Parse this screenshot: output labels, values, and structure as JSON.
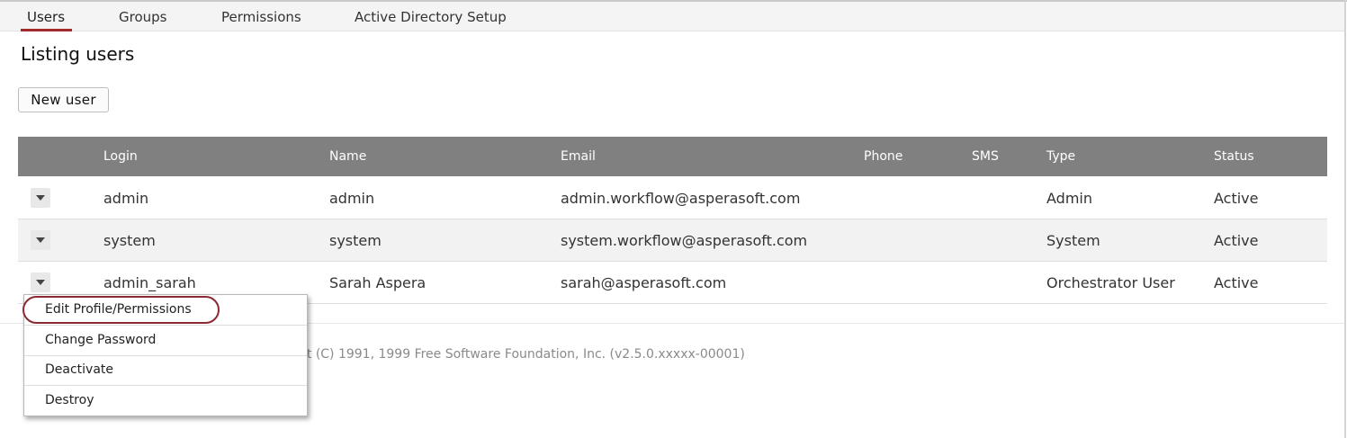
{
  "tabs": [
    {
      "label": "Users",
      "active": true
    },
    {
      "label": "Groups",
      "active": false
    },
    {
      "label": "Permissions",
      "active": false
    },
    {
      "label": "Active Directory Setup",
      "active": false
    }
  ],
  "page_title": "Listing users",
  "new_user_label": "New user",
  "table": {
    "headers": [
      "Login",
      "Name",
      "Email",
      "Phone",
      "SMS",
      "Type",
      "Status"
    ],
    "rows": [
      {
        "login": "admin",
        "name": "admin",
        "email": "admin.workflow@asperasoft.com",
        "phone": "",
        "sms": "",
        "type": "Admin",
        "status": "Active"
      },
      {
        "login": "system",
        "name": "system",
        "email": "system.workflow@asperasoft.com",
        "phone": "",
        "sms": "",
        "type": "System",
        "status": "Active"
      },
      {
        "login": "admin_sarah",
        "name": "Sarah Aspera",
        "email": "sarah@asperasoft.com",
        "phone": "",
        "sms": "",
        "type": "Orchestrator User",
        "status": "Active"
      }
    ]
  },
  "footer_text": "nt (C) 1991, 1999 Free Software Foundation, Inc. (v2.5.0.xxxxx-00001)",
  "row_menu": {
    "items": [
      {
        "label": "Edit Profile/Permissions",
        "highlighted": true
      },
      {
        "label": "Change Password",
        "highlighted": false
      },
      {
        "label": "Deactivate",
        "highlighted": false
      },
      {
        "label": "Destroy",
        "highlighted": false
      }
    ]
  },
  "colors": {
    "accent_underline": "#a32a2a",
    "header_bg": "#808080",
    "highlight_oval": "#8b2a32"
  },
  "icons": {
    "row_toggle": "caret-down-icon"
  }
}
